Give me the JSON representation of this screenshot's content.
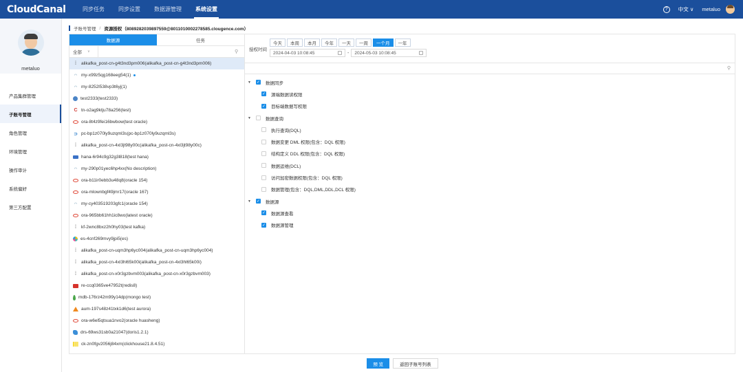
{
  "brand": {
    "logo": "CloudCanal"
  },
  "nav": {
    "items": [
      "同步任务",
      "同步设置",
      "数据源管理",
      "系统设置"
    ],
    "active_index": 3
  },
  "topright": {
    "help_icon": "?",
    "language": "中文 ∨",
    "username": "metaluo"
  },
  "sidebar": {
    "username": "metaluo",
    "items": [
      "产品集群管理",
      "子账号管理",
      "角色管理",
      "环境管理",
      "操作审计",
      "系统偏好",
      "第三方配置"
    ],
    "active_index": 1
  },
  "breadcrumb": {
    "parent": "子账号管理",
    "separator": "/",
    "current": "资源授权（8089282039897559@8011010002278585.clougence.com）"
  },
  "left_panel": {
    "tabs": [
      "数据源",
      "任务"
    ],
    "active_tab": 0,
    "filter_select": "全部",
    "search_placeholder": "",
    "search_icon": "search-icon",
    "items": [
      {
        "icon": "kafka",
        "label": "alikafka_post-cn-g4t3nd3pm006(alikafka_post-cn-g4t3nd3pm006)",
        "selected": true
      },
      {
        "icon": "mysql",
        "label": "my-x99z5qg168eeg54(1)",
        "dot": true
      },
      {
        "icon": "mysql",
        "label": "my-8252l538vp3t6yj(1)"
      },
      {
        "icon": "pg",
        "label": "test2333(test2333)"
      },
      {
        "icon": "c",
        "label": "tn-o2ag9ktju78a256(test)"
      },
      {
        "icon": "oracle",
        "label": "ora-8t4z9fei16bwbow(test oracle)"
      },
      {
        "icon": "pc",
        "label": "pc-bp1z070ly9uzqml3s(pc-bp1z070ly9uzqml3s)"
      },
      {
        "icon": "kafka",
        "label": "alikafka_post-cn-4xl3jt98y00c(alikafka_post-cn-4xl3jt98y00c)"
      },
      {
        "icon": "hana",
        "label": "hana-6r94c9g32g3l818(test hana)"
      },
      {
        "icon": "mysql",
        "label": "my-290p01yec6hp4xx(No description)"
      },
      {
        "icon": "oracle",
        "label": "ora-b11ir0ebb3u48q8(oracle 154)"
      },
      {
        "icon": "oracle",
        "label": "ora-mlownbgf49jmr17(oracle 167)"
      },
      {
        "icon": "mysql",
        "label": "my-cy403519203gfc1(oracle 154)"
      },
      {
        "icon": "oracle",
        "label": "ora-965bb61hh1ic8wo(latest oracle)"
      },
      {
        "icon": "kafka",
        "label": "kf-2wnc8bxz2h0hy03(test kafka)"
      },
      {
        "icon": "es",
        "label": "es-4cnf269mvy9jpi5(es)"
      },
      {
        "icon": "kafka",
        "label": "alikafka_post-cn-uqm3hp6yc004(alikafka_post-cn-uqm3hp6yc004)"
      },
      {
        "icon": "kafka",
        "label": "alikafka_post-cn-4xl3hl65k00i(alikafka_post-cn-4xl3hl65k00i)"
      },
      {
        "icon": "kafka",
        "label": "alikafka_post-cn-x0r3gzbvm003(alikafka_post-cn-x0r3gzbvm003)"
      },
      {
        "icon": "redis",
        "label": "re-ccq0365ve47952t(redis8)"
      },
      {
        "icon": "mongo",
        "label": "mdb-176rz42m99y14dp(mongo test)"
      },
      {
        "icon": "aurora",
        "label": "aum-197s48z41txk1d6(test aurora)"
      },
      {
        "icon": "oracle",
        "label": "ora-w6el5qtsua1nvo2(oracle huasheng)"
      },
      {
        "icon": "doris",
        "label": "drs-69ws31sb0a21047(doris1.2.1)"
      },
      {
        "icon": "ck",
        "label": "ck-zn0fgv2056j84xm(clickhouse21.8.4.51)"
      }
    ]
  },
  "right_panel": {
    "time_label": "授权时间",
    "quick_ranges": [
      "今天",
      "本周",
      "本月",
      "今年",
      "一天",
      "一周",
      "一个月",
      "一年"
    ],
    "active_range_index": 6,
    "start_date": "2024-04-03 10:08:45",
    "date_separator": "-",
    "end_date": "2024-05-03 10:08:45",
    "search_icon": "search-icon",
    "tree": [
      {
        "level": 0,
        "caret": true,
        "checked": true,
        "label": "数据同步"
      },
      {
        "level": 1,
        "checked": true,
        "label": "源端数据读权限"
      },
      {
        "level": 1,
        "checked": true,
        "label": "目标端数据写权限"
      },
      {
        "level": 0,
        "caret": true,
        "checked": false,
        "label": "数据查询"
      },
      {
        "level": 1,
        "checked": false,
        "label": "执行查询(DQL)"
      },
      {
        "level": 1,
        "checked": false,
        "label": "数据变更 DML 权限(包含：DQL 权限)"
      },
      {
        "level": 1,
        "checked": false,
        "label": "结构定义 DDL 权限(包含：DQL 权限)"
      },
      {
        "level": 1,
        "checked": false,
        "label": "数据运维(DCL)"
      },
      {
        "level": 1,
        "checked": false,
        "label": "访问加密数据权限(包含：DQL 权限)"
      },
      {
        "level": 1,
        "checked": false,
        "label": "数据管理(包含：DQL,DML,DDL,DCL 权限)"
      },
      {
        "level": 0,
        "caret": true,
        "checked": true,
        "label": "数据源"
      },
      {
        "level": 1,
        "checked": true,
        "label": "数据源查看"
      },
      {
        "level": 1,
        "checked": true,
        "label": "数据源管理"
      }
    ]
  },
  "footer": {
    "primary": "预 览",
    "secondary": "返回子账号列表"
  },
  "colors": {
    "topbar": "#1b4f9c",
    "accent": "#1b8ee8"
  }
}
